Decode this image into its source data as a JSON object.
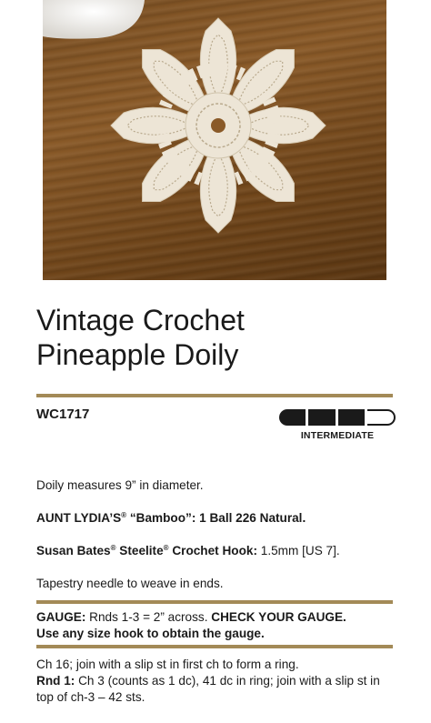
{
  "header": {
    "title_line1": "Vintage Crochet",
    "title_line2": "Pineapple Doily"
  },
  "pattern": {
    "code": "WC1717",
    "skill_level": "INTERMEDIATE"
  },
  "body": {
    "measure": "Doily measures 9” in diameter.",
    "yarn_brand": "AUNT LYDIA’S",
    "reg": "®",
    "yarn_rest": " “Bamboo”: 1 Ball 226 Natural.",
    "hook_brand1": "Susan Bates",
    "hook_brand2": " Steelite",
    "hook_brand3": " Crochet Hook:",
    "hook_size": " 1.5mm [US 7].",
    "tapestry": "Tapestry needle to weave in ends.",
    "gauge_label": "GAUGE:",
    "gauge_text": " Rnds 1-3 = 2” across. ",
    "gauge_check": "CHECK YOUR GAUGE.",
    "gauge_line2": "Use any size hook to obtain the gauge.",
    "start": "Ch 16; join with a slip st in first ch to form a ring.",
    "rnd1_label": "Rnd 1:",
    "rnd1_text": " Ch 3 (counts as 1 dc), 41 dc in ring; join with a slip st in top of ch-3 – 42 sts."
  },
  "colors": {
    "rule": "#a38a57",
    "wood": "#7a4f22",
    "doily": "#ede5d6"
  }
}
